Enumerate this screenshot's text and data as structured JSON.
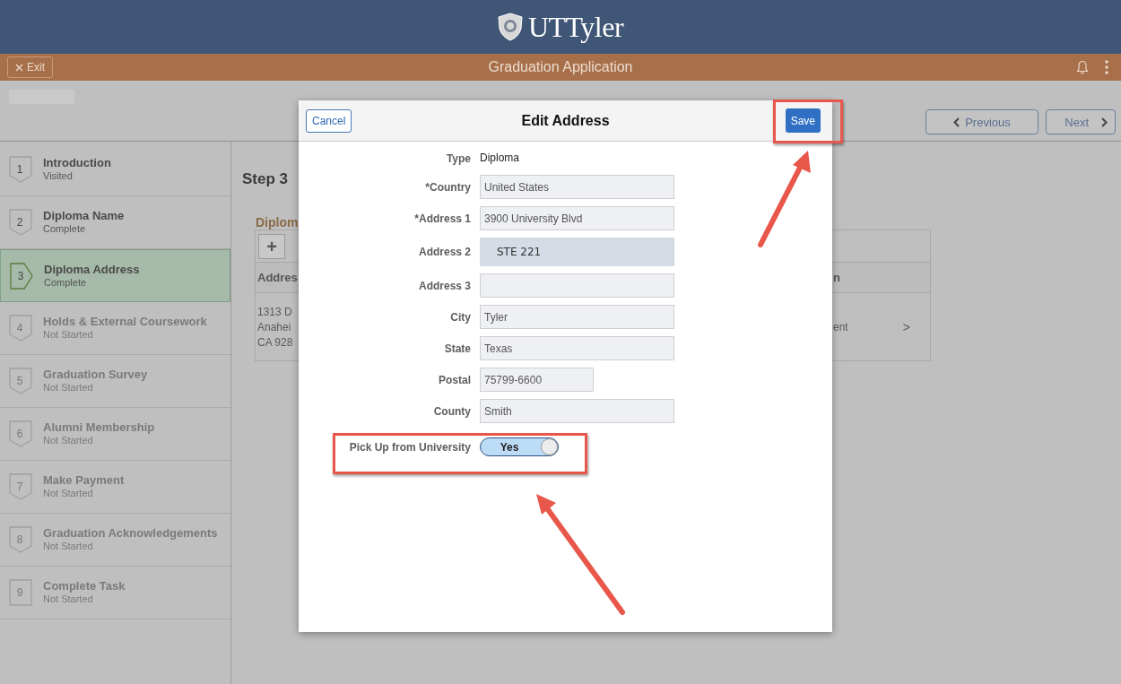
{
  "header": {
    "logo_text": "UTTyler"
  },
  "title_bar": {
    "exit": "Exit",
    "title": "Graduation Application"
  },
  "nav": {
    "previous": "Previous",
    "next": "Next"
  },
  "steps": [
    {
      "number": "1",
      "title": "Introduction",
      "status": "Visited",
      "selected": false,
      "disabled": false
    },
    {
      "number": "2",
      "title": "Diploma Name",
      "status": "Complete",
      "selected": false,
      "disabled": false
    },
    {
      "number": "3",
      "title": "Diploma Address",
      "status": "Complete",
      "selected": true,
      "disabled": false
    },
    {
      "number": "4",
      "title": "Holds & External Coursework",
      "status": "Not Started",
      "selected": false,
      "disabled": true
    },
    {
      "number": "5",
      "title": "Graduation Survey",
      "status": "Not Started",
      "selected": false,
      "disabled": true
    },
    {
      "number": "6",
      "title": "Alumni Membership",
      "status": "Not Started",
      "selected": false,
      "disabled": true
    },
    {
      "number": "7",
      "title": "Make Payment",
      "status": "Not Started",
      "selected": false,
      "disabled": true
    },
    {
      "number": "8",
      "title": "Graduation Acknowledgements",
      "status": "Not Started",
      "selected": false,
      "disabled": true
    },
    {
      "number": "9",
      "title": "Complete Task",
      "status": "Not Started",
      "selected": false,
      "disabled": true
    }
  ],
  "content": {
    "heading": "Step 3",
    "section_title": "Diplom",
    "add_button": "+",
    "table": {
      "column_1": "Addres",
      "column_3": "n",
      "row_column_1": [
        "1313 D",
        "Anahei",
        "CA 928"
      ],
      "row_column_3": "ent",
      "row_chevron": ">"
    }
  },
  "dialog": {
    "cancel": "Cancel",
    "title": "Edit Address",
    "save": "Save",
    "fields": [
      {
        "label": "Type",
        "kind": "text",
        "value": "Diploma"
      },
      {
        "label": "*Country",
        "kind": "field",
        "value": "United States",
        "highlighted": false
      },
      {
        "label": "*Address 1",
        "kind": "field",
        "value": "3900 University Blvd",
        "highlighted": false
      },
      {
        "label": "Address 2",
        "kind": "field",
        "value": "STE 221",
        "highlighted": true
      },
      {
        "label": "Address 3",
        "kind": "field",
        "highlighted": false
      },
      {
        "label": "City",
        "kind": "field",
        "value": "Tyler",
        "highlighted": false
      },
      {
        "label": "State",
        "kind": "field",
        "value": "Texas",
        "highlighted": false
      },
      {
        "label": "Postal",
        "kind": "short",
        "value": "75799-6600",
        "highlighted": false
      },
      {
        "label": "County",
        "kind": "field",
        "value": "Smith",
        "highlighted": false
      }
    ],
    "pickup": {
      "label": "Pick Up from University",
      "value": "Yes",
      "on": true
    }
  }
}
